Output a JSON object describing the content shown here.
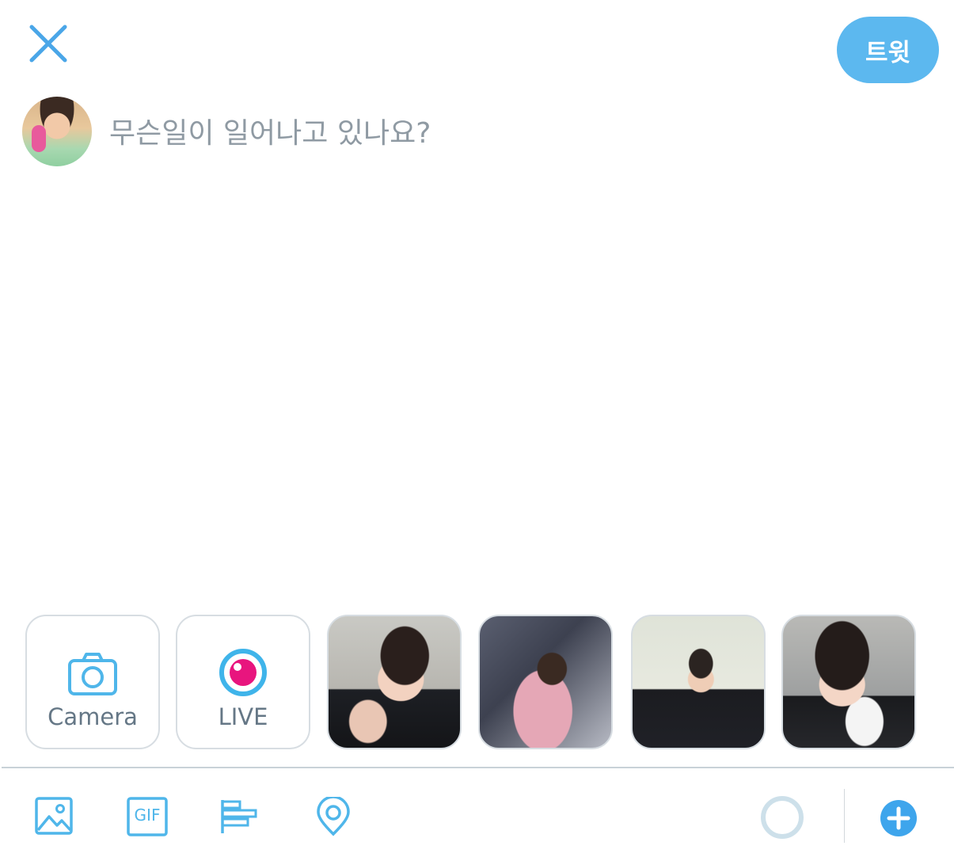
{
  "header": {
    "close_icon": "close-icon",
    "tweet_label": "트윗",
    "accent_color": "#5cb8ef"
  },
  "compose": {
    "placeholder": "무슨일이 일어나고 있나요?"
  },
  "media_picker": {
    "camera_label": "Camera",
    "live_label": "LIVE",
    "live_color": "#e8157e",
    "photos": [
      "photo-1",
      "photo-2",
      "photo-3",
      "photo-4"
    ]
  },
  "toolbar": {
    "icons": [
      "image-icon",
      "gif-icon",
      "poll-icon",
      "location-icon",
      "character-count-ring",
      "add-thread-icon"
    ],
    "gif_text": "GIF"
  }
}
